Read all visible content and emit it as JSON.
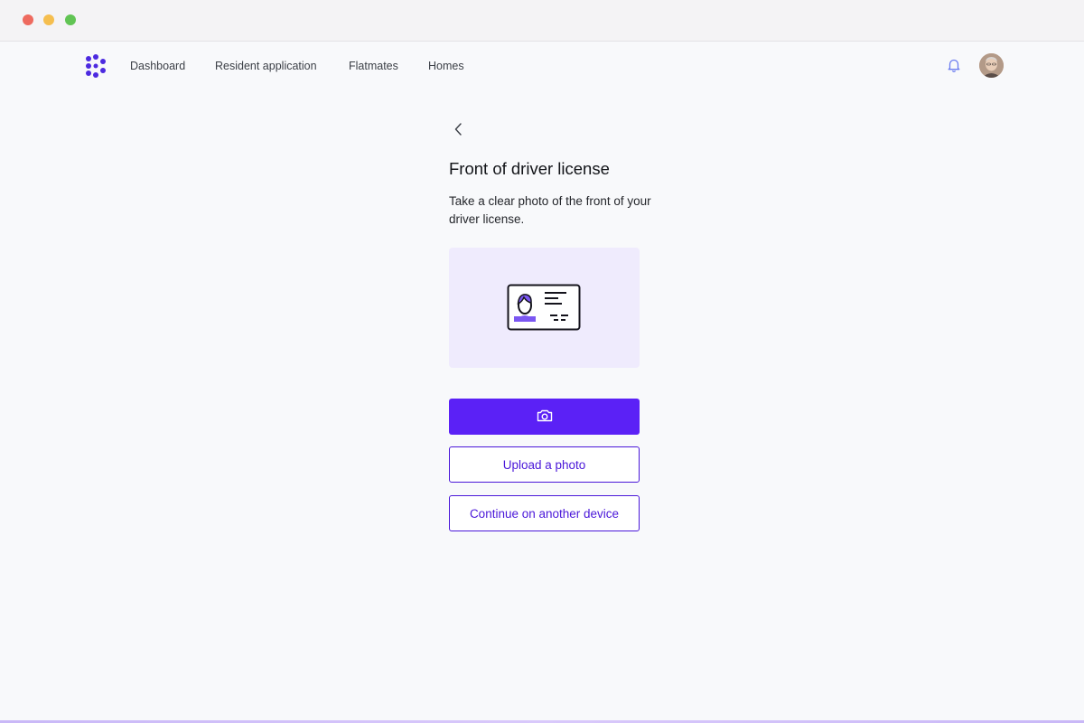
{
  "nav": {
    "links": [
      {
        "label": "Dashboard"
      },
      {
        "label": "Resident application"
      },
      {
        "label": "Flatmates"
      },
      {
        "label": "Homes"
      }
    ],
    "icons": {
      "logo": "brand-logo",
      "bell": "bell-icon",
      "avatar": "user-avatar"
    }
  },
  "page": {
    "title": "Front of driver license",
    "description": "Take a clear photo of the front of your driver license.",
    "illustration": "id-card-icon"
  },
  "actions": {
    "camera_icon": "camera-icon",
    "upload_label": "Upload a photo",
    "continue_label": "Continue on another device"
  },
  "colors": {
    "accent": "#5b21f6",
    "outline": "#4a17d9",
    "illustration_bg": "#efebfd"
  }
}
